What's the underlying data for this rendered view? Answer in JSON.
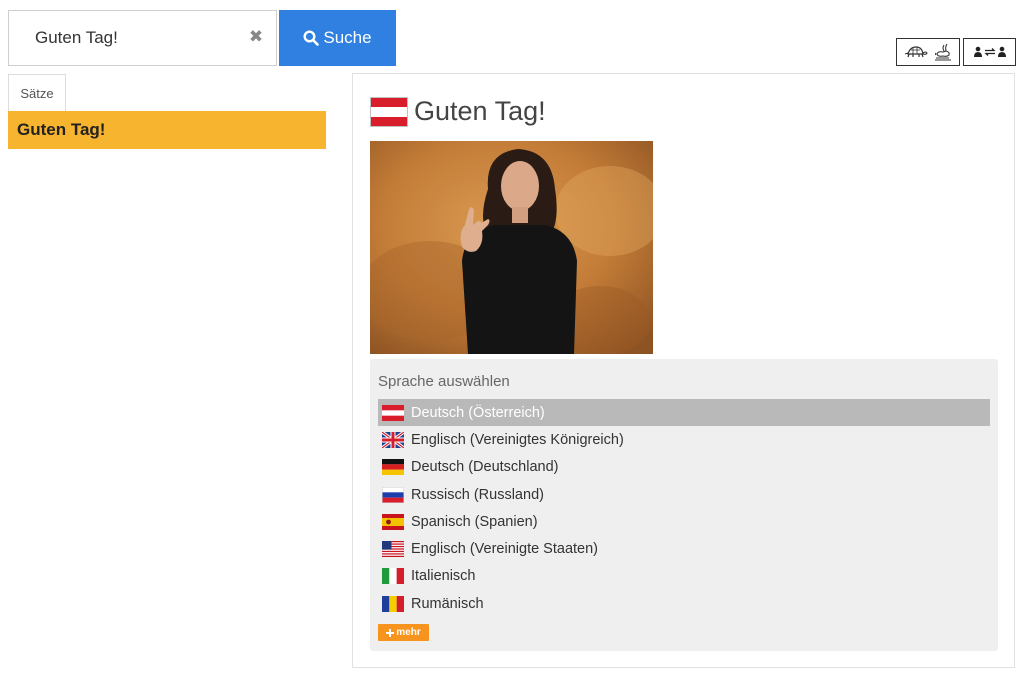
{
  "search": {
    "value": "Guten Tag!",
    "clear_symbol": "✖",
    "button_label": "Suche"
  },
  "left_panel": {
    "tab_label": "Sätze",
    "results": [
      {
        "label": "Guten Tag!"
      }
    ]
  },
  "detail": {
    "title": "Guten Tag!",
    "title_flag": "flag-austria-icon",
    "language_heading": "Sprache auswählen",
    "languages": [
      {
        "label": "Deutsch (Österreich)",
        "flag": "flag-austria-icon",
        "selected": true
      },
      {
        "label": "Englisch (Vereinigtes Königreich)",
        "flag": "flag-uk-icon",
        "selected": false
      },
      {
        "label": "Deutsch (Deutschland)",
        "flag": "flag-germany-icon",
        "selected": false
      },
      {
        "label": "Russisch (Russland)",
        "flag": "flag-russia-icon",
        "selected": false
      },
      {
        "label": "Spanisch (Spanien)",
        "flag": "flag-spain-icon",
        "selected": false
      },
      {
        "label": "Englisch (Vereinigte Staaten)",
        "flag": "flag-usa-icon",
        "selected": false
      },
      {
        "label": "Italienisch",
        "flag": "flag-italy-icon",
        "selected": false
      },
      {
        "label": "Rumänisch",
        "flag": "flag-romania-icon",
        "selected": false
      }
    ],
    "more_label": "mehr"
  },
  "colors": {
    "search_button": "#2f80e0",
    "result_highlight": "#f7b42e",
    "more_button": "#f7941d",
    "selected_language": "#b9b9b9"
  }
}
